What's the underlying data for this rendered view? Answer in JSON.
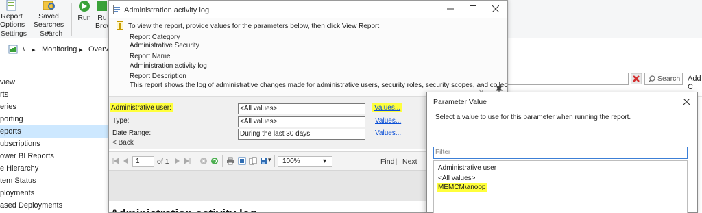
{
  "ribbon": {
    "report_options": [
      "Report",
      "Options"
    ],
    "saved_searches": [
      "Saved",
      "Searches ▾"
    ],
    "run": "Run",
    "run_browse": [
      "Ru",
      "Brow"
    ],
    "group_settings": "Settings",
    "group_search": "Search"
  },
  "address_bar": {
    "sep1": "\\",
    "arrow1": "▸",
    "crumb_monitoring": "Monitoring",
    "arrow2": "▸",
    "crumb_overview": "Overvi"
  },
  "nav": {
    "items": [
      "view",
      "rts",
      "eries",
      "porting",
      "eports",
      "ubscriptions",
      "ower BI Reports",
      "e Hierarchy",
      "tem Status",
      "ployments",
      "ased Deployments"
    ]
  },
  "right_pane": {
    "search_label": "Search",
    "add_label": "Add C"
  },
  "dialog": {
    "title": "Administration activity log",
    "info": "To view the report, provide values for the parameters below, then click View Report.",
    "report_category_label": "Report Category",
    "report_category_value": "Administrative Security",
    "report_name_label": "Report Name",
    "report_name_value": "Administration activity log",
    "report_description_label": "Report Description",
    "report_description_value": "This report shows the log of administrative changes made for administrative users, security roles, security scopes, and collections."
  },
  "parameters": [
    {
      "label": "Administrative user:",
      "value": "<All values>",
      "link": "Values..."
    },
    {
      "label": "Type:",
      "value": "<All values>",
      "link": "Values..."
    },
    {
      "label": "Date Range:",
      "value": "During the last 30 days",
      "link": "Values..."
    }
  ],
  "back_label": "< Back",
  "toolbar": {
    "page": "1",
    "of_pages": "of 1",
    "zoom": "100%",
    "zoom_arrow": "▾",
    "find": "Find",
    "sep": "|",
    "next": "Next"
  },
  "report_heading": "Administration activity log",
  "popup": {
    "title": "Parameter Value",
    "instruction": "Select a value to use for this parameter when running the report.",
    "filter_placeholder": "Filter",
    "list_header": "Administrative user",
    "items": [
      "<All values>",
      "MEMCM\\anoop"
    ]
  },
  "colors": {
    "highlight": "#ffff3b",
    "link": "#0b4fd6",
    "selected_nav": "#cde8ff",
    "focus_border": "#3c7fd6"
  },
  "icons": [
    "report-options-icon",
    "saved-searches-icon",
    "run-icon",
    "run-browse-icon",
    "console-icon",
    "report-file-icon",
    "warning-info-icon",
    "clear-icon",
    "search-icon",
    "first-page-icon",
    "prev-page-icon",
    "next-page-icon",
    "last-page-icon",
    "stop-icon",
    "refresh-icon",
    "print-icon",
    "print-layout-icon",
    "page-setup-icon",
    "export-icon",
    "scroll-up-icon",
    "scroll-down-icon",
    "pin-icon",
    "close-icon"
  ]
}
